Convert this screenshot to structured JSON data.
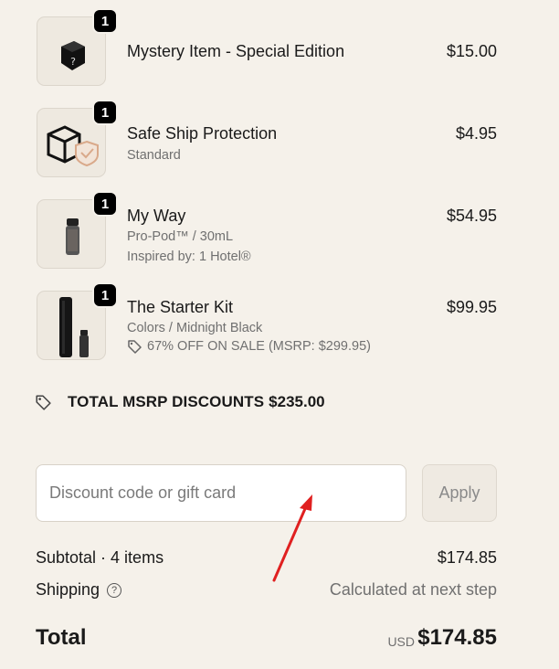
{
  "items": [
    {
      "name": "Mystery Item - Special Edition",
      "price": "$15.00",
      "qty": "1",
      "icon": "mystery-box-icon"
    },
    {
      "name": "Safe Ship Protection",
      "variant": "Standard",
      "price": "$4.95",
      "qty": "1",
      "icon": "shipping-shield-icon"
    },
    {
      "name": "My Way",
      "variant": "Pro-Pod™ / 30mL",
      "inspired": "Inspired by: 1 Hotel®",
      "price": "$54.95",
      "qty": "1",
      "icon": "pod-bottle-icon"
    },
    {
      "name": "The Starter Kit",
      "variant": "Colors / Midnight Black",
      "sale": "67% OFF ON SALE (MSRP: $299.95)",
      "price": "$99.95",
      "qty": "1",
      "icon": "diffuser-kit-icon"
    }
  ],
  "msrp": {
    "label": "TOTAL MSRP DISCOUNTS",
    "amount": "$235.00"
  },
  "discount": {
    "placeholder": "Discount code or gift card",
    "apply_label": "Apply"
  },
  "summary": {
    "subtotal_label": "Subtotal · 4 items",
    "subtotal_value": "$174.85",
    "shipping_label": "Shipping",
    "shipping_value": "Calculated at next step",
    "total_label": "Total",
    "total_currency": "USD",
    "total_value": "$174.85"
  },
  "colors": {
    "background": "#f5f1ea",
    "badge": "#000000",
    "annotation_arrow": "#e02020"
  }
}
